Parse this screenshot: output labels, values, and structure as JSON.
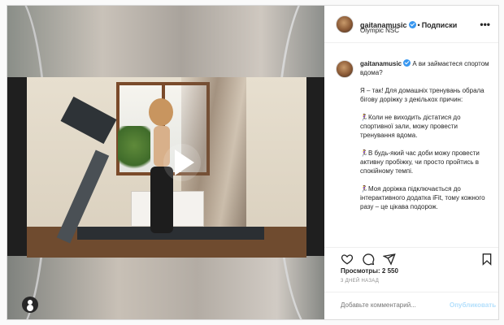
{
  "post": {
    "username": "gaitanamusic",
    "follow_label": "Подписки",
    "location": "Olympic NSC",
    "more_label": "•••"
  },
  "caption": {
    "username": "gaitanamusic",
    "paragraphs": [
      "А ви займаєтеся спортом вдома?",
      "Я – так! Для домашніх тренувань обрала бігову доріжку з декількох причин:",
      "🏃‍♀️Коли не виходить дістатися до спортивної зали, можу провести тренування вдома.",
      "🏃‍♀️В будь-який час доби можу провести активну пробіжку, чи просто пройтись в спокійному темпі.",
      "🏃‍♀️Моя доріжка підключається до інтерактивного додатка iFit, тому кожного разу – це цікава подорож."
    ]
  },
  "stats": {
    "views": "Просмотры: 2 550",
    "time_ago": "3 ДНЕЙ НАЗАД"
  },
  "comment": {
    "placeholder": "Добавьте комментарий...",
    "publish_label": "Опубликовать"
  },
  "icons": {
    "verified": "verified-badge-icon",
    "like": "heart-icon",
    "comment": "comment-icon",
    "share": "paper-plane-icon",
    "save": "bookmark-icon",
    "play": "play-icon",
    "tagged": "user-tag-icon"
  },
  "colors": {
    "verified": "#3897f0",
    "publish_disabled": "#b2dffc"
  }
}
